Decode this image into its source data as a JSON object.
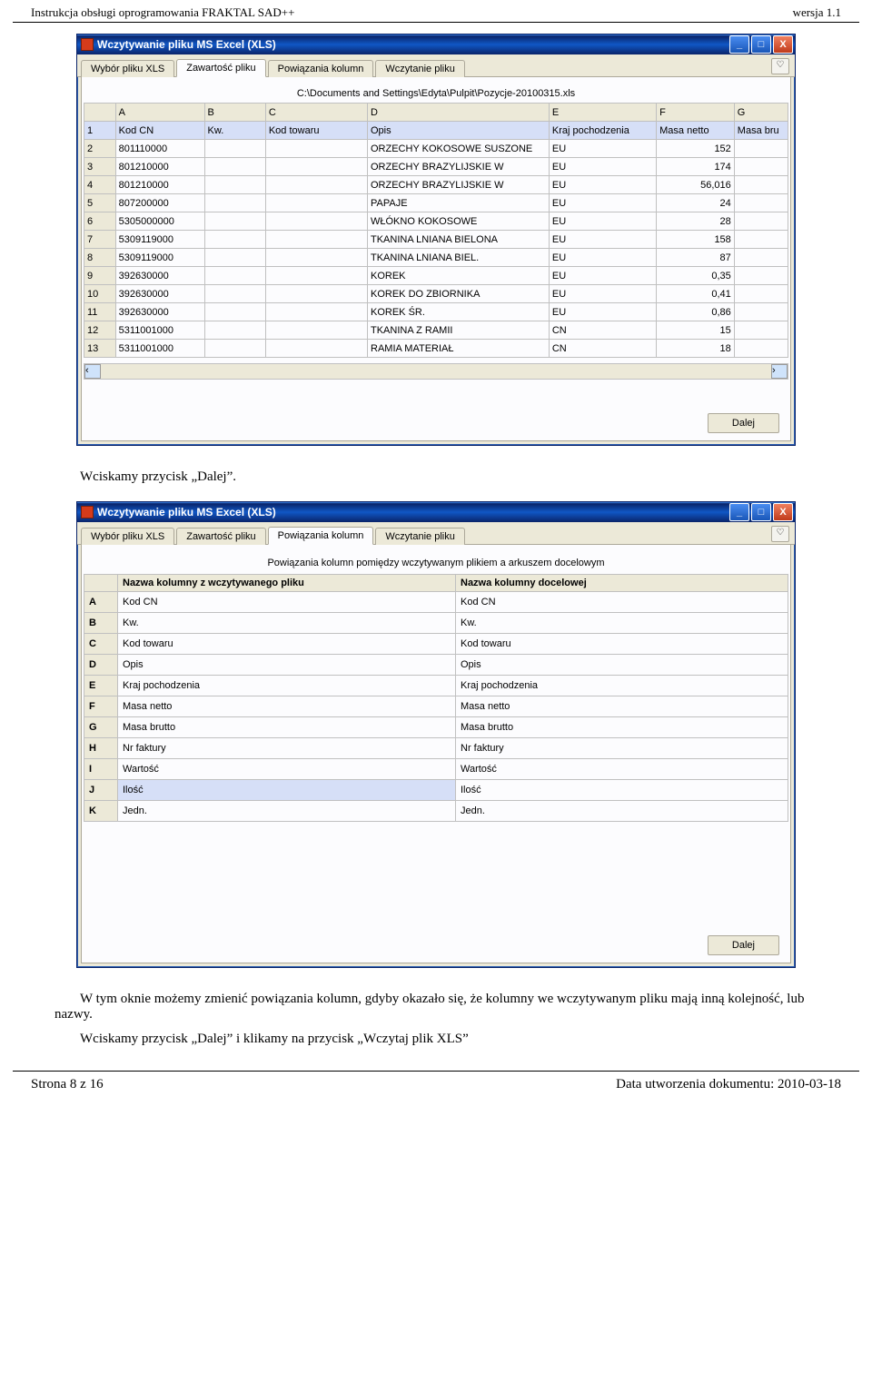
{
  "page_header": {
    "left": "Instrukcja obsługi oprogramowania FRAKTAL SAD++",
    "right": "wersja  1.1"
  },
  "page_footer": {
    "left": "Strona 8 z 16",
    "right": "Data utworzenia dokumentu: 2010-03-18"
  },
  "text": {
    "p1": "Wciskamy przycisk „Dalej”.",
    "p2": "W tym oknie możemy zmienić powiązania kolumn, gdyby okazało się, że kolumny we wczytywanym pliku mają inną kolejność, lub nazwy.",
    "p3": "Wciskamy przycisk „Dalej” i klikamy na przycisk „Wczytaj plik XLS”"
  },
  "window1": {
    "title": "Wczytywanie pliku MS Excel (XLS)",
    "tabs": [
      "Wybór pliku XLS",
      "Zawartość pliku",
      "Powiązania kolumn",
      "Wczytanie pliku"
    ],
    "active_tab": 1,
    "file_path": "C:\\Documents and Settings\\Edyta\\Pulpit\\Pozycje-20100315.xls",
    "col_letters": [
      "A",
      "B",
      "C",
      "D",
      "E",
      "F",
      "G"
    ],
    "header_row": [
      "1",
      "Kod CN",
      "Kw.",
      "Kod towaru",
      "Opis",
      "Kraj pochodzenia",
      "Masa netto",
      "Masa bru"
    ],
    "rows": [
      [
        "2",
        "801110000",
        "",
        "",
        "ORZECHY KOKOSOWE SUSZONE",
        "EU",
        "152",
        ""
      ],
      [
        "3",
        "801210000",
        "",
        "",
        "ORZECHY BRAZYLIJSKIE W",
        "EU",
        "174",
        ""
      ],
      [
        "4",
        "801210000",
        "",
        "",
        "ORZECHY BRAZYLIJSKIE W",
        "EU",
        "56,016",
        ""
      ],
      [
        "5",
        "807200000",
        "",
        "",
        "PAPAJE",
        "EU",
        "24",
        ""
      ],
      [
        "6",
        "5305000000",
        "",
        "",
        "WŁÓKNO KOKOSOWE",
        "EU",
        "28",
        ""
      ],
      [
        "7",
        "5309119000",
        "",
        "",
        "TKANINA LNIANA BIELONA",
        "EU",
        "158",
        ""
      ],
      [
        "8",
        "5309119000",
        "",
        "",
        "TKANINA LNIANA BIEL.",
        "EU",
        "87",
        ""
      ],
      [
        "9",
        "392630000",
        "",
        "",
        "KOREK",
        "EU",
        "0,35",
        ""
      ],
      [
        "10",
        "392630000",
        "",
        "",
        "KOREK DO ZBIORNIKA",
        "EU",
        "0,41",
        ""
      ],
      [
        "11",
        "392630000",
        "",
        "",
        "KOREK ŚR.",
        "EU",
        "0,86",
        ""
      ],
      [
        "12",
        "5311001000",
        "",
        "",
        "TKANINA Z RAMII",
        "CN",
        "15",
        ""
      ],
      [
        "13",
        "5311001000",
        "",
        "",
        "RAMIA MATERIAŁ",
        "CN",
        "18",
        ""
      ]
    ],
    "next_label": "Dalej"
  },
  "window2": {
    "title": "Wczytywanie pliku MS Excel (XLS)",
    "tabs": [
      "Wybór pliku XLS",
      "Zawartość pliku",
      "Powiązania kolumn",
      "Wczytanie pliku"
    ],
    "active_tab": 2,
    "heading": "Powiązania kolumn pomiędzy wczytywanym plikiem a arkuszem docelowym",
    "header": [
      "",
      "Nazwa kolumny z wczytywanego pliku",
      "Nazwa kolumny docelowej"
    ],
    "rows": [
      [
        "A",
        "Kod CN",
        "Kod CN"
      ],
      [
        "B",
        "Kw.",
        "Kw."
      ],
      [
        "C",
        "Kod towaru",
        "Kod towaru"
      ],
      [
        "D",
        "Opis",
        "Opis"
      ],
      [
        "E",
        "Kraj pochodzenia",
        "Kraj pochodzenia"
      ],
      [
        "F",
        "Masa netto",
        "Masa netto"
      ],
      [
        "G",
        "Masa brutto",
        "Masa brutto"
      ],
      [
        "H",
        "Nr faktury",
        "Nr faktury"
      ],
      [
        "I",
        "Wartość",
        "Wartość"
      ],
      [
        "J",
        "Ilość",
        "Ilość"
      ],
      [
        "K",
        "Jedn.",
        "Jedn."
      ]
    ],
    "selected_row": 9,
    "next_label": "Dalej"
  }
}
